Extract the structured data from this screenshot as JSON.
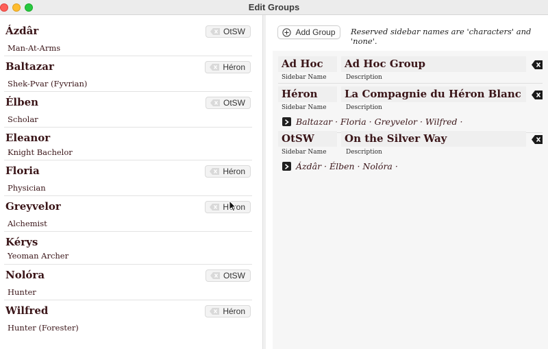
{
  "window": {
    "title": "Edit Groups"
  },
  "characters": [
    {
      "name": "Ázdâr",
      "role": "Man-At-Arms",
      "group": "OtSW"
    },
    {
      "name": "Baltazar",
      "role": "Shek-Pvar (Fyvrian)",
      "group": "Héron"
    },
    {
      "name": "Élben",
      "role": "Scholar",
      "group": "OtSW"
    },
    {
      "name": "Eleanor",
      "role": "Knight Bachelor",
      "group": ""
    },
    {
      "name": "Floria",
      "role": "Physician",
      "group": "Héron"
    },
    {
      "name": "Greyvelor",
      "role": "Alchemist",
      "group": "Héron"
    },
    {
      "name": "Kérys",
      "role": "Yeoman Archer",
      "group": ""
    },
    {
      "name": "Nolóra",
      "role": "Hunter",
      "group": "OtSW"
    },
    {
      "name": "Wilfred",
      "role": "Hunter (Forester)",
      "group": "Héron"
    }
  ],
  "toolbar": {
    "add_group_label": "Add Group",
    "reserved_note": "Reserved sidebar names are 'characters' and 'none'."
  },
  "captions": {
    "sidebar_name": "Sidebar Name",
    "description": "Description"
  },
  "groups": [
    {
      "sidebar_name": "Ad Hoc",
      "description": "Ad Hoc Group",
      "members": ""
    },
    {
      "sidebar_name": "Héron",
      "description": "La Compagnie du Héron Blanc",
      "members": "Baltazar · Floria · Greyvelor · Wilfred ·"
    },
    {
      "sidebar_name": "OtSW",
      "description": "On the Silver Way",
      "members": "Ázdâr · Élben · Nolóra ·"
    }
  ],
  "icons": {
    "traffic_close": "close-icon",
    "traffic_min": "minimize-icon",
    "traffic_max": "maximize-icon",
    "remove_tag": "remove-tag-icon",
    "add": "plus-circle-icon",
    "delete_group": "delete-icon",
    "expand": "chevron-right-icon",
    "cursor": "mouse-pointer-icon"
  },
  "colors": {
    "text_dark_red": "#3a1518",
    "close": "#fe5f57",
    "minimize": "#febc2e",
    "maximize": "#28c840"
  }
}
